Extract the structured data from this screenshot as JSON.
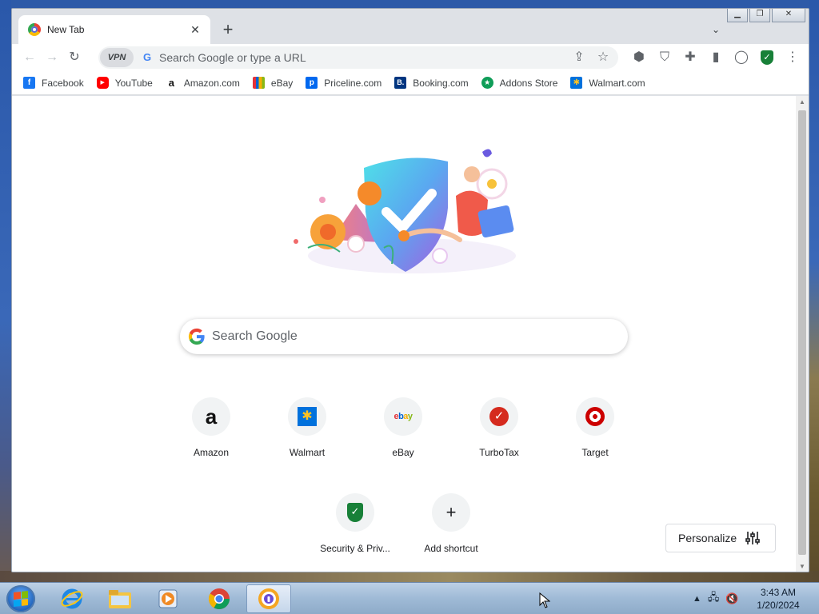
{
  "browser": {
    "tab": {
      "title": "New Tab"
    },
    "omnibox": {
      "vpn_label": "VPN",
      "placeholder": "Search Google or type a URL"
    },
    "bookmarks": [
      {
        "label": "Facebook",
        "icon": "facebook-icon",
        "color": "#1877f2",
        "glyph": "f"
      },
      {
        "label": "YouTube",
        "icon": "youtube-icon",
        "color": "#ff0000",
        "glyph": "▶"
      },
      {
        "label": "Amazon.com",
        "icon": "amazon-icon",
        "color": "#ffffff",
        "glyph": "a"
      },
      {
        "label": "eBay",
        "icon": "ebay-icon",
        "color": "#ffffff",
        "glyph": "🛍"
      },
      {
        "label": "Priceline.com",
        "icon": "priceline-icon",
        "color": "#0068ef",
        "glyph": "p"
      },
      {
        "label": "Booking.com",
        "icon": "booking-icon",
        "color": "#003580",
        "glyph": "B."
      },
      {
        "label": "Addons Store",
        "icon": "addons-store-icon",
        "color": "#0f9d58",
        "glyph": "★"
      },
      {
        "label": "Walmart.com",
        "icon": "walmart-icon",
        "color": "#0071dc",
        "glyph": "✱"
      }
    ]
  },
  "newtab": {
    "search_placeholder": "Search Google",
    "shortcuts": [
      {
        "label": "Amazon",
        "icon": "amazon-icon"
      },
      {
        "label": "Walmart",
        "icon": "walmart-icon"
      },
      {
        "label": "eBay",
        "icon": "ebay-icon"
      },
      {
        "label": "TurboTax",
        "icon": "turbotax-icon"
      },
      {
        "label": "Target",
        "icon": "target-icon"
      },
      {
        "label": "Security & Priv...",
        "icon": "security-shield-icon"
      },
      {
        "label": "Add shortcut",
        "icon": "plus-icon"
      }
    ],
    "personalize_label": "Personalize"
  },
  "taskbar": {
    "time": "3:43 AM",
    "date": "1/20/2024"
  },
  "colors": {
    "accent_blue": "#4285f4",
    "shield_green": "#188038",
    "turbotax_red": "#d52b1e",
    "target_red": "#cc0000"
  }
}
